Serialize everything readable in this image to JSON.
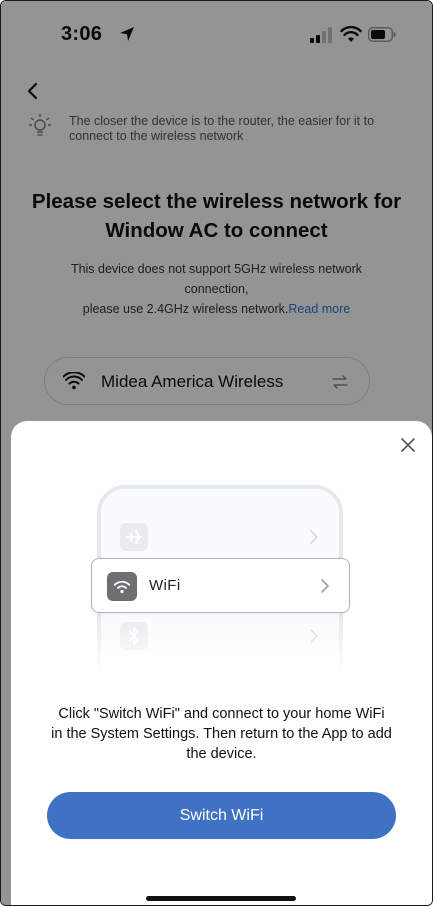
{
  "status_bar": {
    "time": "3:06"
  },
  "page": {
    "tip": "The closer the device is to the router, the easier for it to connect to the wireless network",
    "headline": "Please select the wireless network for Window AC to connect",
    "support_text": "This device does not support 5GHz wireless network connection,",
    "support_text_2": "please use 2.4GHz wireless network.",
    "read_more": "Read more",
    "network_name": "Midea America Wireless"
  },
  "sheet": {
    "illustration_wifi_label": "WiFi",
    "instructions": "Click \"Switch WiFi\" and connect to your home WiFi in the System Settings. Then return to the App to add the device.",
    "switch_button": "Switch WiFi"
  },
  "colors": {
    "accent": "#3f72c2",
    "link": "#2f6fc8",
    "overlay": "rgba(0,0,0,0.40)"
  },
  "icons": [
    "location-arrow-icon",
    "signal-icon",
    "wifi-icon",
    "battery-icon",
    "back-icon",
    "lightbulb-icon",
    "swap-icon",
    "close-icon",
    "airplane-icon",
    "bluetooth-icon",
    "chevron-right-icon"
  ]
}
